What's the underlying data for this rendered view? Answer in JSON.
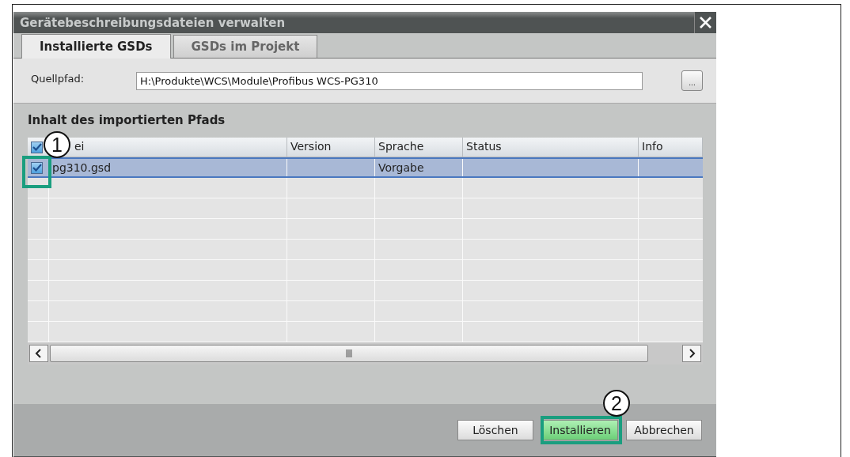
{
  "window": {
    "title": "Gerätebeschreibungsdateien verwalten"
  },
  "tabs": [
    {
      "label": "Installierte GSDs",
      "selected": true
    },
    {
      "label": "GSDs im Projekt",
      "selected": false
    }
  ],
  "source_path": {
    "label": "Quellpfad:",
    "value": "H:\\Produkte\\WCS\\Module\\Profibus WCS-PG310",
    "browse_button": "..."
  },
  "section": {
    "title": "Inhalt des importierten Pfads"
  },
  "table": {
    "header_checked": true,
    "columns": [
      "ei",
      "Version",
      "Sprache",
      "Status",
      "Info"
    ],
    "rows": [
      {
        "checked": true,
        "selected": true,
        "cells": [
          "pg310.gsd",
          "",
          "Vorgabe",
          "",
          ""
        ]
      }
    ]
  },
  "buttons": [
    {
      "label": "Löschen",
      "highlighted": false
    },
    {
      "label": "Installieren",
      "highlighted": true
    },
    {
      "label": "Abbrechen",
      "highlighted": false
    }
  ],
  "callouts": [
    {
      "label": "1"
    },
    {
      "label": "2"
    }
  ]
}
